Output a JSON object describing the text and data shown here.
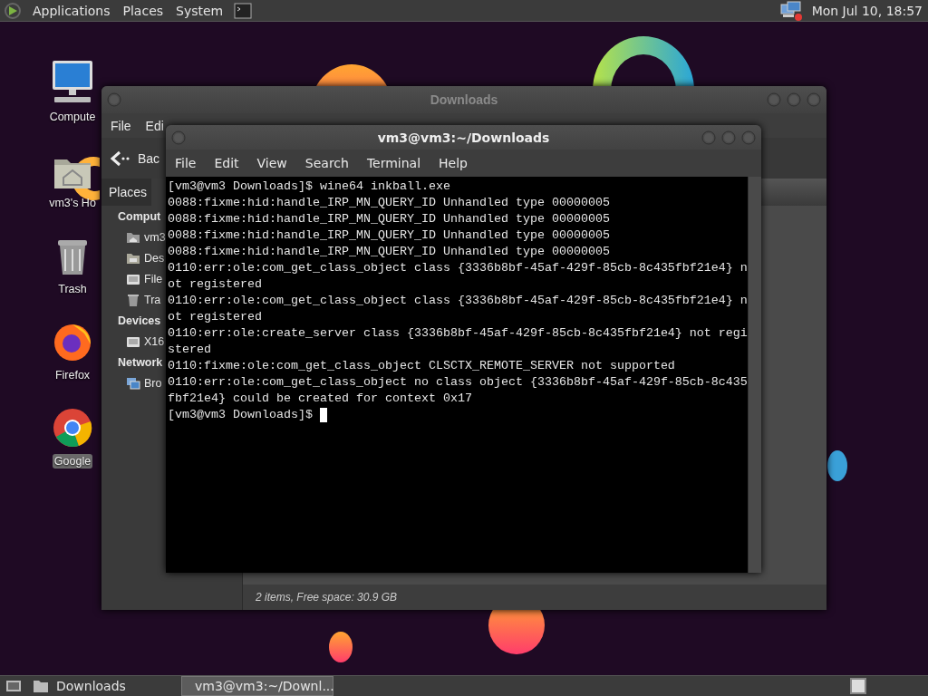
{
  "top_panel": {
    "menus": [
      "Applications",
      "Places",
      "System"
    ],
    "clock": "Mon Jul 10, 18:57"
  },
  "desktop_icons": [
    {
      "kind": "computer",
      "label": "Compute",
      "selected": false
    },
    {
      "kind": "home",
      "label": "vm3's Ho",
      "selected": false
    },
    {
      "kind": "trash",
      "label": "Trash",
      "selected": false
    },
    {
      "kind": "firefox",
      "label": "Firefox",
      "selected": false
    },
    {
      "kind": "browser",
      "label": "Google",
      "selected": true
    }
  ],
  "file_manager": {
    "title": "Downloads",
    "menu": [
      "File",
      "Edi"
    ],
    "back": "Bac",
    "sidebar_tab": "Places",
    "sections": [
      {
        "heading": "Comput",
        "items": [
          {
            "kind": "home",
            "label": "vm3"
          },
          {
            "kind": "desktop",
            "label": "Des"
          },
          {
            "kind": "drive",
            "label": "File"
          },
          {
            "kind": "trash",
            "label": "Tra"
          }
        ]
      },
      {
        "heading": "Devices",
        "items": [
          {
            "kind": "drive",
            "label": "X16"
          }
        ]
      },
      {
        "heading": "Network",
        "items": [
          {
            "kind": "network",
            "label": "Bro"
          }
        ]
      }
    ],
    "status": "2 items, Free space: 30.9 GB"
  },
  "terminal": {
    "title": "vm3@vm3:~/Downloads",
    "menu": [
      "File",
      "Edit",
      "View",
      "Search",
      "Terminal",
      "Help"
    ],
    "lines": [
      "[vm3@vm3 Downloads]$ wine64 inkball.exe",
      "0088:fixme:hid:handle_IRP_MN_QUERY_ID Unhandled type 00000005",
      "0088:fixme:hid:handle_IRP_MN_QUERY_ID Unhandled type 00000005",
      "0088:fixme:hid:handle_IRP_MN_QUERY_ID Unhandled type 00000005",
      "0088:fixme:hid:handle_IRP_MN_QUERY_ID Unhandled type 00000005",
      "0110:err:ole:com_get_class_object class {3336b8bf-45af-429f-85cb-8c435fbf21e4} n",
      "ot registered",
      "0110:err:ole:com_get_class_object class {3336b8bf-45af-429f-85cb-8c435fbf21e4} n",
      "ot registered",
      "0110:err:ole:create_server class {3336b8bf-45af-429f-85cb-8c435fbf21e4} not regi",
      "stered",
      "0110:fixme:ole:com_get_class_object CLSCTX_REMOTE_SERVER not supported",
      "0110:err:ole:com_get_class_object no class object {3336b8bf-45af-429f-85cb-8c435",
      "fbf21e4} could be created for context 0x17"
    ],
    "prompt": "[vm3@vm3 Downloads]$"
  },
  "taskbar": {
    "tasks": [
      {
        "kind": "folder",
        "label": "Downloads",
        "selected": false
      },
      {
        "kind": "terminal",
        "label": "vm3@vm3:~/Downl...",
        "selected": true
      }
    ]
  }
}
